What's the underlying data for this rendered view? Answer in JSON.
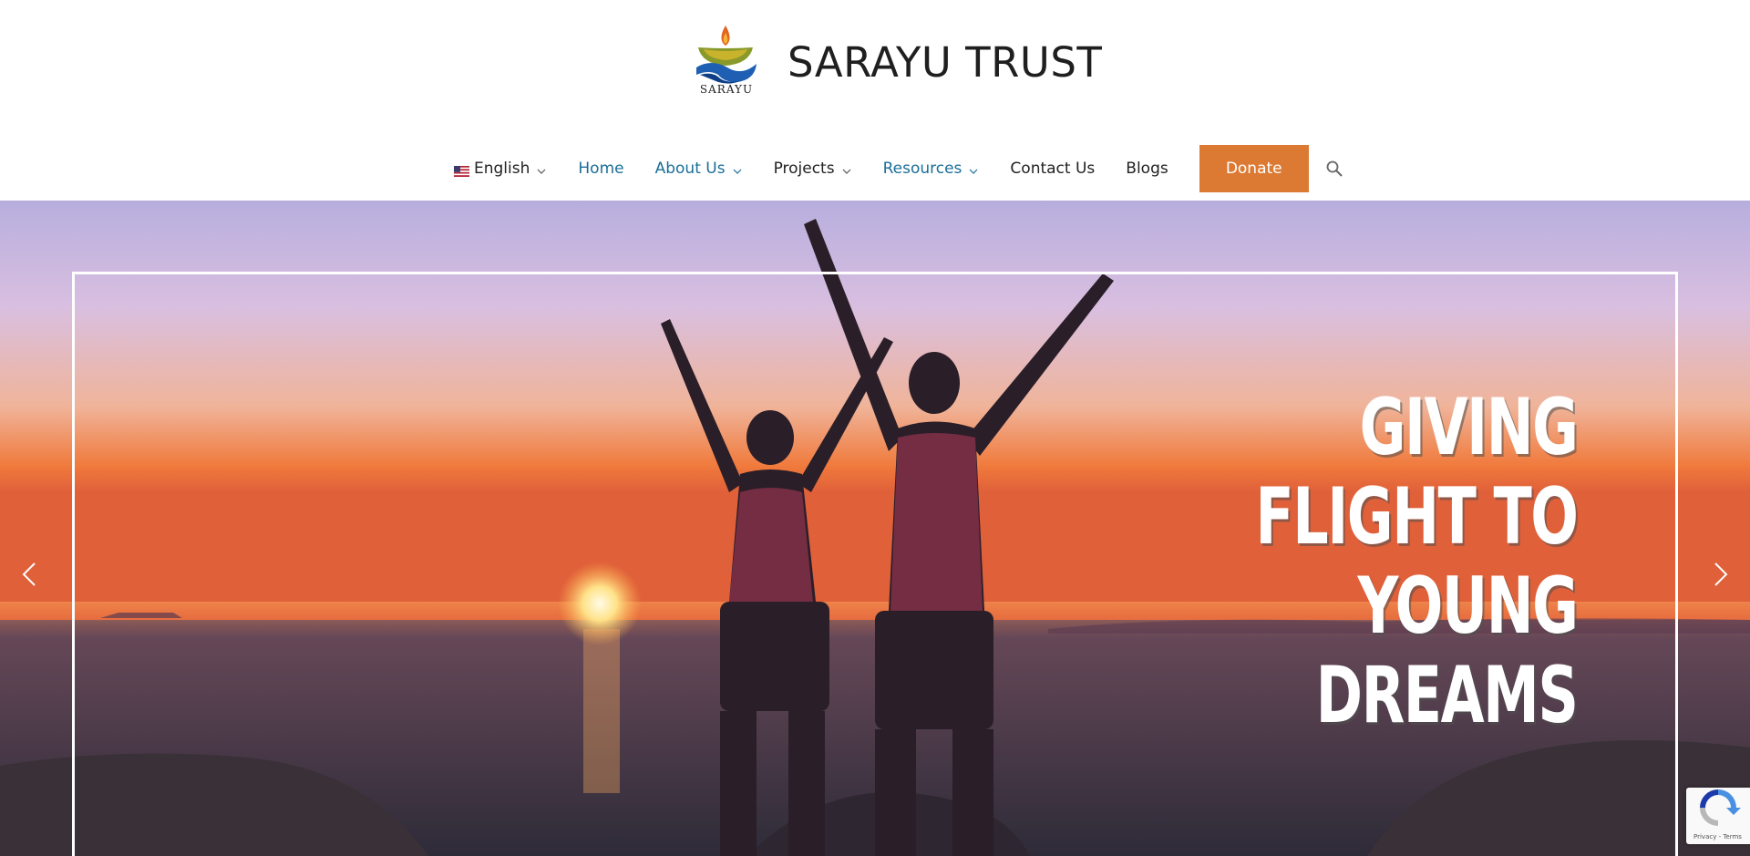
{
  "site": {
    "title": "SARAYU TRUST",
    "logo_text": "SARAYU"
  },
  "nav": {
    "language": "English",
    "items": [
      {
        "label": "Home",
        "color": "#1a6e98",
        "has_dropdown": false
      },
      {
        "label": "About Us",
        "color": "#1a6e98",
        "has_dropdown": true
      },
      {
        "label": "Projects",
        "color": "#222222",
        "has_dropdown": true
      },
      {
        "label": "Resources",
        "color": "#1a6e98",
        "has_dropdown": true
      },
      {
        "label": "Contact Us",
        "color": "#222222",
        "has_dropdown": false
      },
      {
        "label": "Blogs",
        "color": "#222222",
        "has_dropdown": false
      }
    ],
    "donate_label": "Donate",
    "donate_color": "#dc7a33",
    "search_icon": "search-icon"
  },
  "hero": {
    "headline_lines": [
      "GIVING",
      "FLIGHT TO",
      "YOUNG",
      "DREAMS"
    ],
    "prev_icon": "chevron-left-icon",
    "next_icon": "chevron-right-icon"
  },
  "recaptcha": {
    "links": "Privacy - Terms"
  }
}
